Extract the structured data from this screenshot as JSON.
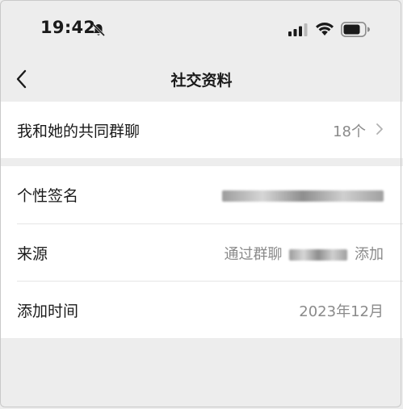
{
  "status_bar": {
    "time": "19:42"
  },
  "nav": {
    "title": "社交资料"
  },
  "common_groups": {
    "label": "我和她的共同群聊",
    "value": "18个"
  },
  "signature": {
    "label": "个性签名"
  },
  "source": {
    "label": "来源",
    "value_prefix": "通过群聊",
    "value_suffix": "添加"
  },
  "added_time": {
    "label": "添加时间",
    "value": "2023年12月"
  },
  "icons": {
    "bell": "bell-slash-icon",
    "signal": "cellular-signal-icon",
    "wifi": "wifi-icon",
    "battery": "battery-icon",
    "back": "chevron-left-icon",
    "chevron": "chevron-right-icon"
  },
  "colors": {
    "background": "#ededed",
    "card": "#ffffff",
    "secondary_text": "#8a8a8a"
  }
}
